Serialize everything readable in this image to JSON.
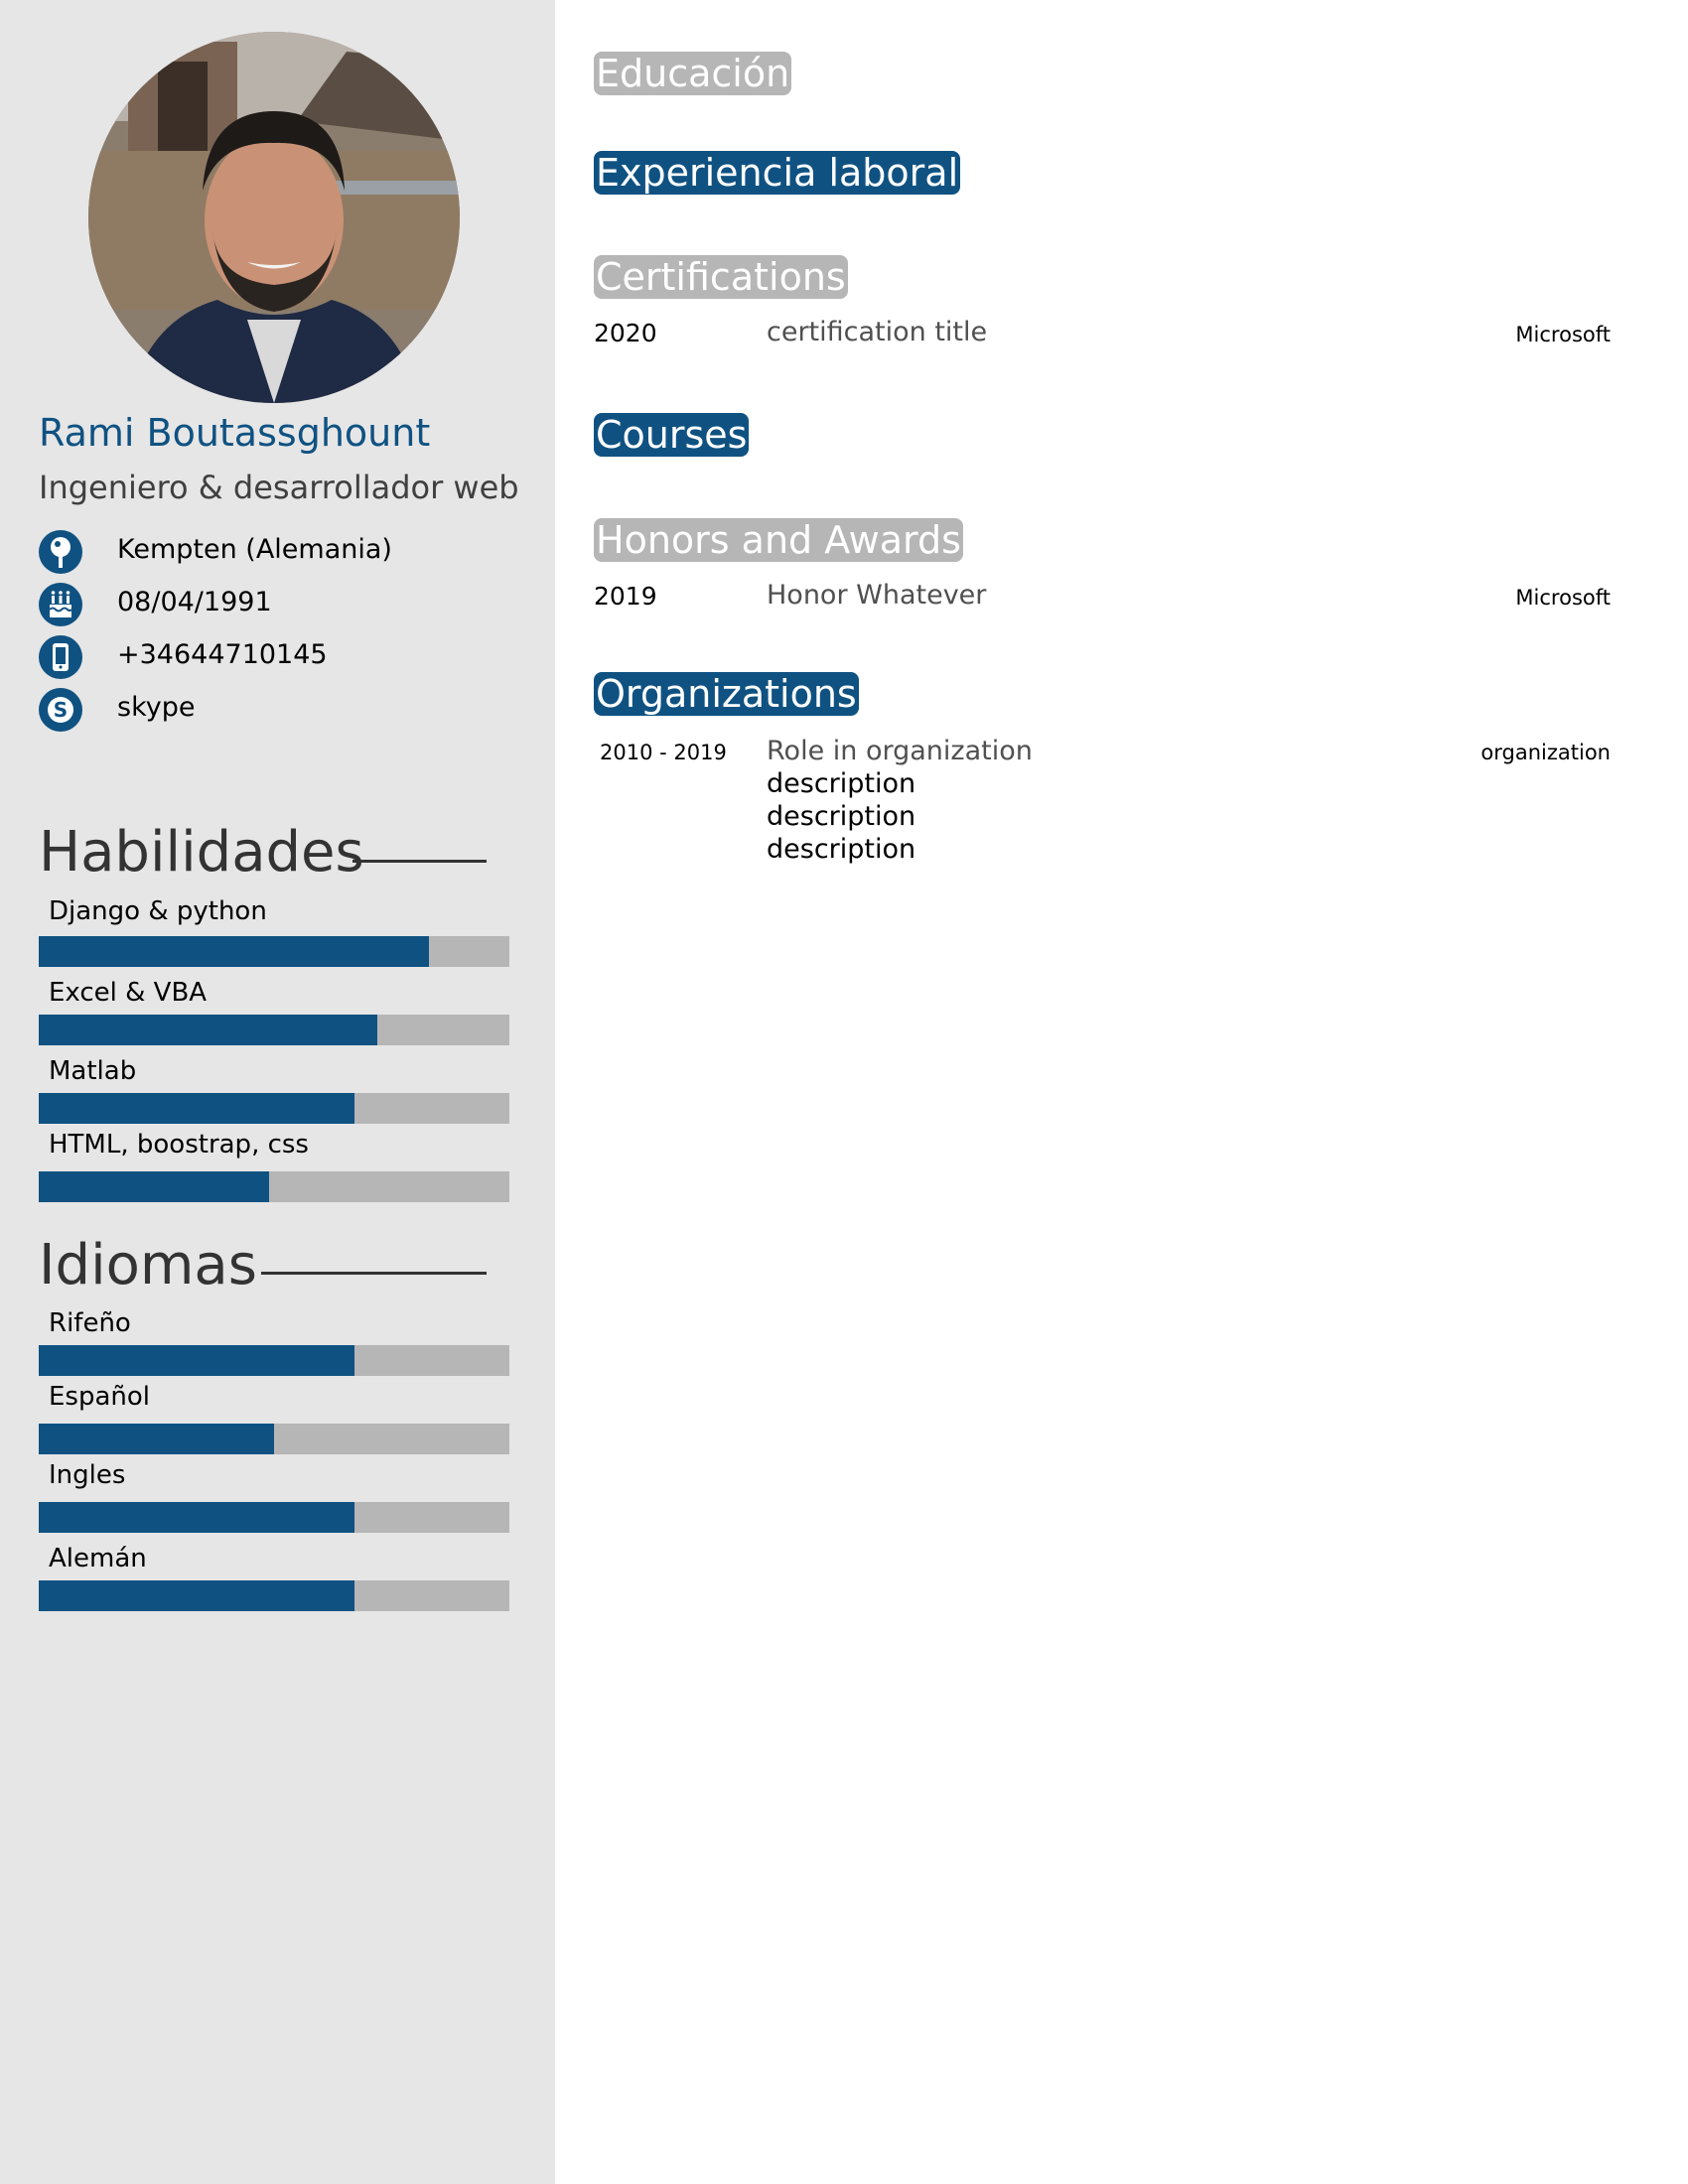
{
  "profile": {
    "name": "Rami Boutassghount",
    "role": "Ingeniero & desarrollador web",
    "contacts": [
      {
        "icon": "location-pin-icon",
        "text": "Kempten (Alemania)"
      },
      {
        "icon": "birthday-cake-icon",
        "text": "08/04/1991"
      },
      {
        "icon": "mobile-phone-icon",
        "text": "+34644710145"
      },
      {
        "icon": "skype-icon",
        "text": "skype"
      }
    ]
  },
  "skills": {
    "title": "Habilidades",
    "items": [
      {
        "label": "Django & python",
        "level": 0.83
      },
      {
        "label": "Excel & VBA",
        "level": 0.72
      },
      {
        "label": "Matlab",
        "level": 0.67
      },
      {
        "label": "HTML, boostrap, css",
        "level": 0.49
      }
    ]
  },
  "languages": {
    "title": "Idiomas",
    "items": [
      {
        "label": "Rifeño",
        "level": 0.67
      },
      {
        "label": "Español",
        "level": 0.5
      },
      {
        "label": "Ingles",
        "level": 0.67
      },
      {
        "label": "Alemán",
        "level": 0.67
      }
    ]
  },
  "sections": {
    "education": {
      "title": "Educación"
    },
    "experience": {
      "title": "Experiencia laboral"
    },
    "certifications": {
      "title": "Certifications",
      "entry": {
        "date": "2020",
        "title": "certification title",
        "org": "Microsoft"
      }
    },
    "courses": {
      "title": "Courses"
    },
    "honors": {
      "title": "Honors and Awards",
      "entry": {
        "date": "2019",
        "title": "Honor Whatever",
        "org": "Microsoft"
      }
    },
    "organizations": {
      "title": "Organizations",
      "entry": {
        "date": "2010 - 2019",
        "title": "Role in organization",
        "org": "organization",
        "descriptions": [
          "description",
          "description",
          "description"
        ]
      }
    }
  },
  "colors": {
    "accent": "#0f5282",
    "tag_gray": "#b6b6b6",
    "sidebar_bg": "#e6e6e6"
  }
}
